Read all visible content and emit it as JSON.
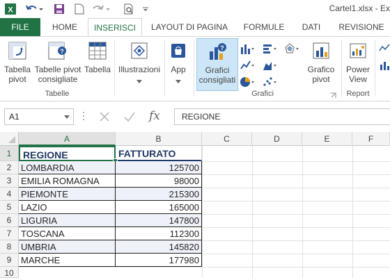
{
  "app_title": "Cartel1.xlsx - Ex",
  "tabs": [
    {
      "label": "FILE"
    },
    {
      "label": "HOME"
    },
    {
      "label": "INSERISCI"
    },
    {
      "label": "LAYOUT DI PAGINA"
    },
    {
      "label": "FORMULE"
    },
    {
      "label": "DATI"
    },
    {
      "label": "REVISIONE"
    }
  ],
  "ribbon": {
    "tabella_pivot": "Tabella\npivot",
    "tabelle_pivot_consigliate": "Tabelle pivot\nconsigliate",
    "tabella": "Tabella",
    "illustrazioni": "Illustrazioni",
    "app": "App",
    "grafici_consigliati": "Grafici\nconsigliati",
    "grafico_pivot": "Grafico\npivot",
    "power_view": "Power\nView",
    "group_tabelle": "Tabelle",
    "group_grafici": "Grafici",
    "group_report": "Report"
  },
  "formula_bar": {
    "name_box": "A1",
    "fx": "fx",
    "content": "REGIONE"
  },
  "columns": [
    "A",
    "B",
    "C",
    "D",
    "E",
    "F"
  ],
  "rows": [
    "1",
    "2",
    "3",
    "4",
    "5",
    "6",
    "7",
    "8",
    "9",
    "10"
  ],
  "table": {
    "headers": [
      "REGIONE",
      "FATTURATO"
    ],
    "data": [
      {
        "regione": "LOMBARDIA",
        "fatturato": "125700"
      },
      {
        "regione": "EMILIA ROMAGNA",
        "fatturato": "98000"
      },
      {
        "regione": "PIEMONTE",
        "fatturato": "215300"
      },
      {
        "regione": "LAZIO",
        "fatturato": "165000"
      },
      {
        "regione": "LIGURIA",
        "fatturato": "147800"
      },
      {
        "regione": "TOSCANA",
        "fatturato": "112300"
      },
      {
        "regione": "UMBRIA",
        "fatturato": "145820"
      },
      {
        "regione": "MARCHE",
        "fatturato": "177980"
      }
    ]
  },
  "colors": {
    "excel_green": "#217346",
    "header_text": "#1f3864",
    "band_fill": "#eef1f8"
  }
}
